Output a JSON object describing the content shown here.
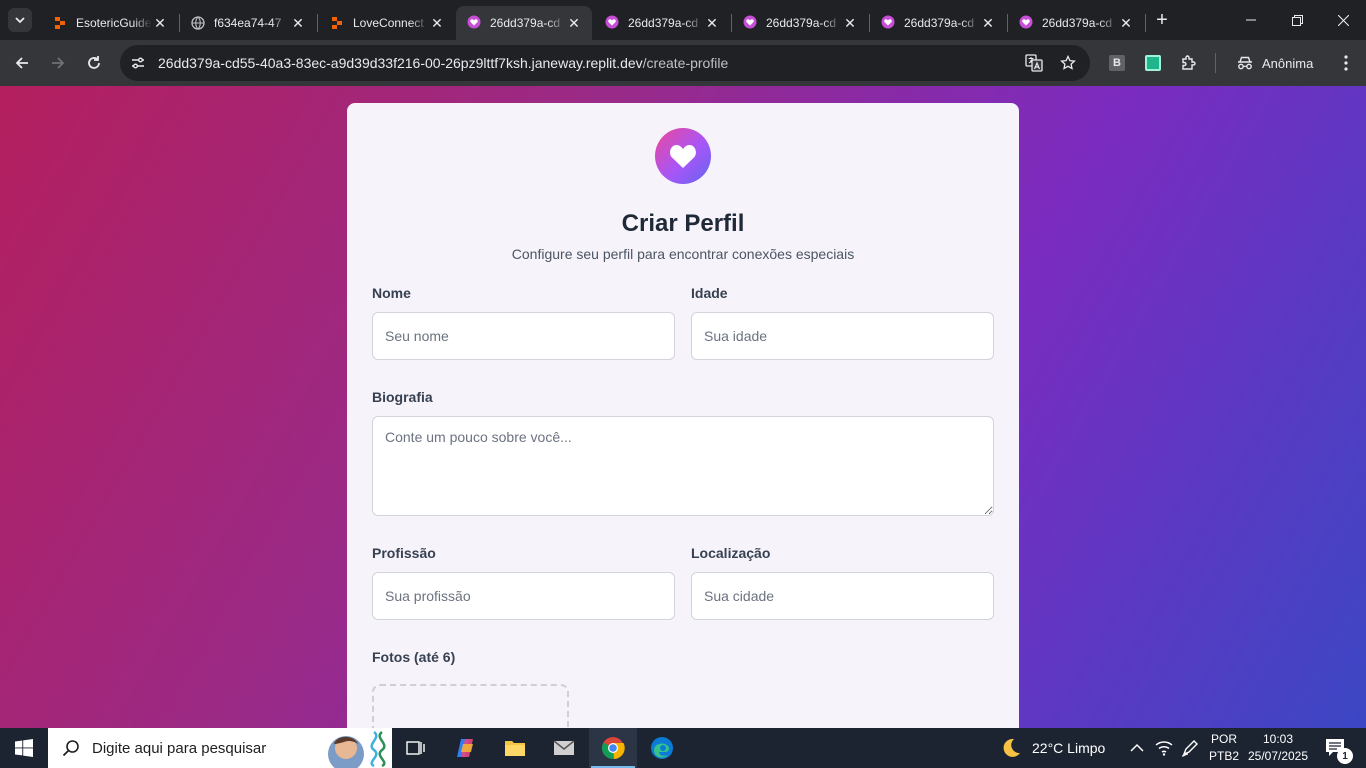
{
  "browser": {
    "tabs": [
      {
        "title": "EsotericGuide",
        "favicon": "replit-icon"
      },
      {
        "title": "f634ea74-47",
        "favicon": "globe-icon"
      },
      {
        "title": "LoveConnect",
        "favicon": "replit-icon"
      },
      {
        "title": "26dd379a-cd",
        "favicon": "heart-pin-icon",
        "active": true
      },
      {
        "title": "26dd379a-cd",
        "favicon": "heart-pin-icon"
      },
      {
        "title": "26dd379a-cd",
        "favicon": "heart-pin-icon"
      },
      {
        "title": "26dd379a-cd",
        "favicon": "heart-pin-icon"
      },
      {
        "title": "26dd379a-cd",
        "favicon": "heart-pin-icon"
      }
    ],
    "url_host": "26dd379a-cd55-40a3-83ec-a9d39d33f216-00-26pz9lttf7ksh.janeway.replit.dev",
    "url_path": "/create-profile",
    "extension_b_label": "B",
    "profile_label": "Anônima"
  },
  "page": {
    "title": "Criar Perfil",
    "subtitle": "Configure seu perfil para encontrar conexões especiais",
    "fields": {
      "name": {
        "label": "Nome",
        "placeholder": "Seu nome",
        "value": ""
      },
      "age": {
        "label": "Idade",
        "placeholder": "Sua idade",
        "value": ""
      },
      "bio": {
        "label": "Biografia",
        "placeholder": "Conte um pouco sobre você...",
        "value": ""
      },
      "profession": {
        "label": "Profissão",
        "placeholder": "Sua profissão",
        "value": ""
      },
      "location": {
        "label": "Localização",
        "placeholder": "Sua cidade",
        "value": ""
      }
    },
    "photos_label": "Fotos (até 6)",
    "colors": {
      "accent_pink": "#ec4899",
      "accent_purple": "#a855f7",
      "accent_indigo": "#6366f1"
    }
  },
  "taskbar": {
    "search_placeholder": "Digite aqui para pesquisar",
    "weather": "22°C  Limpo",
    "lang_top": "POR",
    "lang_bottom": "PTB2",
    "time": "10:03",
    "date": "25/07/2025",
    "notification_count": "1"
  }
}
